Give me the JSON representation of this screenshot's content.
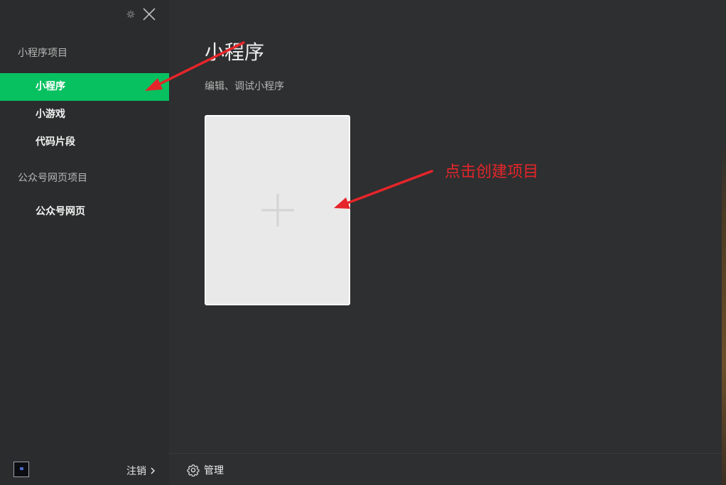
{
  "sidebar": {
    "group1_title": "小程序项目",
    "items1": [
      {
        "label": "小程序"
      },
      {
        "label": "小游戏"
      },
      {
        "label": "代码片段"
      }
    ],
    "group2_title": "公众号网页项目",
    "items2": [
      {
        "label": "公众号网页"
      }
    ],
    "footer": {
      "logout_label": "注销"
    }
  },
  "main": {
    "title": "小程序",
    "subtitle": "编辑、调试小程序"
  },
  "annotation": {
    "text": "点击创建项目",
    "color": "#e5252a"
  },
  "footer": {
    "manage_label": "管理"
  },
  "colors": {
    "accent": "#07c160",
    "sidebar_bg": "#2b2c2d",
    "main_bg": "#2e2f30",
    "card_bg": "#e9e9e9"
  },
  "icons": {
    "settings": "gear-icon",
    "close": "close-icon",
    "add": "plus-icon",
    "logout_arrow": "chevron-right-icon",
    "manage": "gear-icon"
  }
}
